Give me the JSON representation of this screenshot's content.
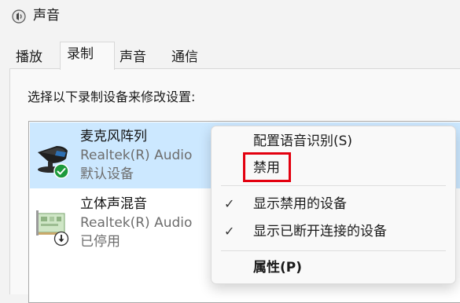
{
  "window": {
    "title": "声音",
    "icon": "speaker-icon"
  },
  "tabs": [
    {
      "label": "播放",
      "active": false
    },
    {
      "label": "录制",
      "active": true
    },
    {
      "label": "声音",
      "active": false
    },
    {
      "label": "通信",
      "active": false
    }
  ],
  "panel": {
    "instruction": "选择以下录制设备来修改设置:"
  },
  "devices": [
    {
      "name": "麦克风阵列",
      "driver": "Realtek(R) Audio",
      "status": "默认设备",
      "icon": "microphone-icon",
      "badge": "default-check-badge-icon",
      "selected": true
    },
    {
      "name": "立体声混音",
      "driver": "Realtek(R) Audio",
      "status": "已停用",
      "icon": "sound-card-icon",
      "badge": "disabled-arrow-badge-icon",
      "selected": false
    }
  ],
  "context_menu": {
    "items": [
      {
        "label": "配置语音识别(S)",
        "checked": false,
        "bold": false
      },
      {
        "label": "禁用",
        "checked": false,
        "bold": false,
        "highlighted": true
      },
      {
        "label": "显示禁用的设备",
        "checked": true,
        "bold": false
      },
      {
        "label": "显示已断开连接的设备",
        "checked": true,
        "bold": false
      },
      {
        "label": "属性(P)",
        "checked": false,
        "bold": true
      }
    ],
    "check_glyph": "✓"
  },
  "colors": {
    "selection": "#cce8ff",
    "highlight_border": "#e3000f",
    "check_badge": "#1d9a3c"
  }
}
